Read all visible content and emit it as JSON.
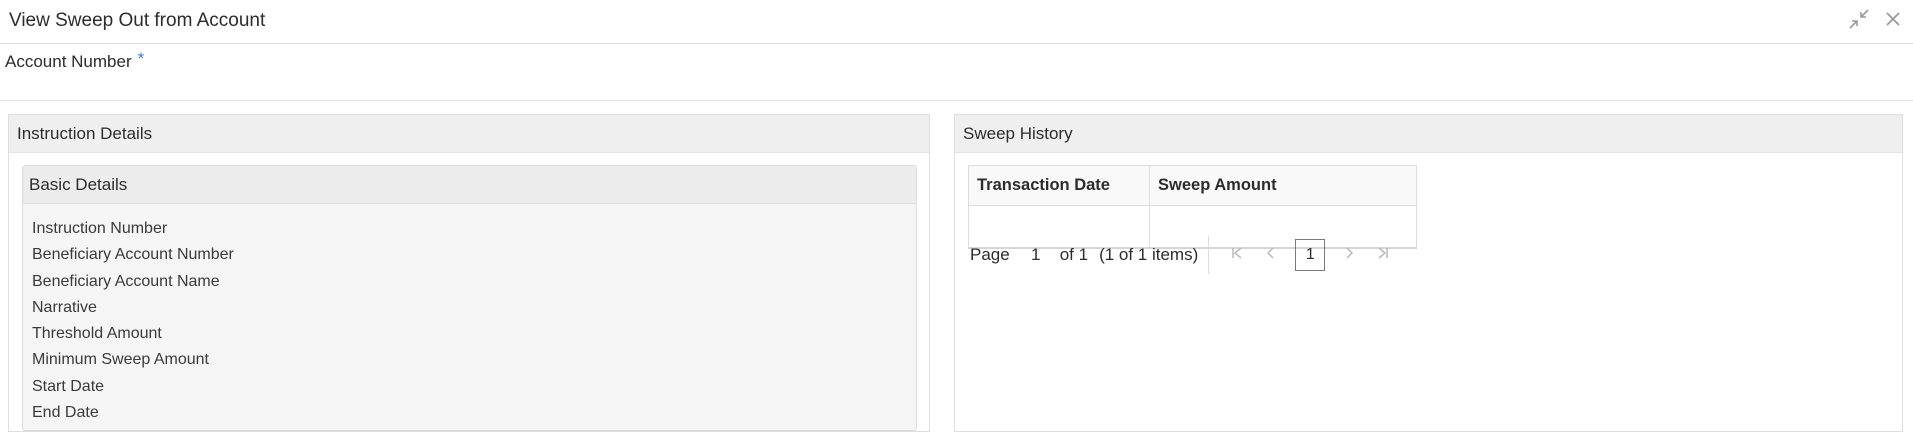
{
  "window": {
    "title": "View Sweep Out from Account",
    "collapse_icon": "collapse-icon",
    "close_icon": "close-icon"
  },
  "account": {
    "label": "Account Number",
    "required_marker": "*"
  },
  "instruction_details": {
    "title": "Instruction Details",
    "basic_details": {
      "title": "Basic Details",
      "fields": [
        "Instruction Number",
        "Beneficiary Account Number",
        "Beneficiary Account Name",
        "Narrative",
        "Threshold Amount",
        "Minimum Sweep Amount",
        "Start Date",
        "End Date"
      ]
    }
  },
  "sweep_history": {
    "title": "Sweep History",
    "columns": [
      "Transaction Date",
      "Sweep Amount"
    ],
    "rows": [
      [
        "",
        ""
      ]
    ],
    "pagination": {
      "page_label": "Page",
      "page_value": "1",
      "of_label": "of 1",
      "items_label": "(1 of 1 items)",
      "current_page": "1",
      "icons": [
        "first-page-icon",
        "prev-page-icon",
        "next-page-icon",
        "last-page-icon"
      ]
    }
  },
  "colors": {
    "required_marker": "#3b7dd8",
    "panel_header_bg": "#efefef",
    "border": "#dcdcdc",
    "disabled_nav": "#b9b9b9"
  }
}
